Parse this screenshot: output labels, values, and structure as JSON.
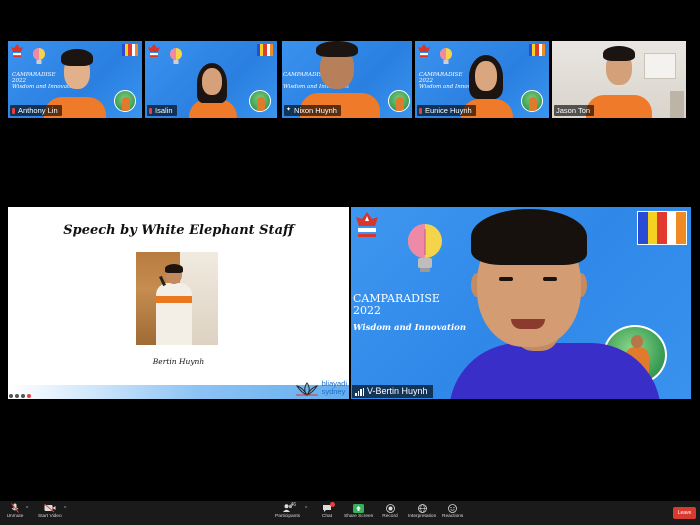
{
  "app": "Zoom Meeting",
  "accent": "#2f86e6",
  "shirt_color": "#ef7a2a",
  "gallery": [
    {
      "name": "Anthony Lin",
      "background": "Camparadise virtual background",
      "muted": true
    },
    {
      "name": "Isalin",
      "background": "Camparadise virtual background",
      "muted": true
    },
    {
      "name": "Nixon Huynh",
      "background": "Camparadise virtual background",
      "pinned": true
    },
    {
      "name": "Eunice Huynh",
      "background": "Camparadise virtual background",
      "muted": true
    },
    {
      "name": "Jason Ton",
      "background": "room"
    }
  ],
  "tile_backdrop": {
    "line1": "CAMPARADISE",
    "line2": "2022",
    "line3": "Wisdom and Innovation"
  },
  "shared_screen": {
    "title": "Speech by White Elephant Staff",
    "caption": "Bertin Huynh",
    "brand_line1": "bliayadi",
    "brand_line2": "sydney"
  },
  "speaker": {
    "name": "V-Bertin Huynh",
    "backdrop_title": "CAMPARADISE",
    "backdrop_year": "2022",
    "backdrop_subtitle": "Wisdom and Innovation"
  },
  "toolbar": {
    "unmute": "Unmute",
    "start_video": "Start Video",
    "participants": "Participants",
    "participants_count": "46",
    "chat": "Chat",
    "share_screen": "Share Screen",
    "record": "Record",
    "interpretation": "Interpretation",
    "reactions": "Reactions",
    "leave": "Leave"
  },
  "flag_colors": [
    "#2a4bd6",
    "#f5d21f",
    "#e23a2f",
    "#ffffff",
    "#f08a24"
  ]
}
